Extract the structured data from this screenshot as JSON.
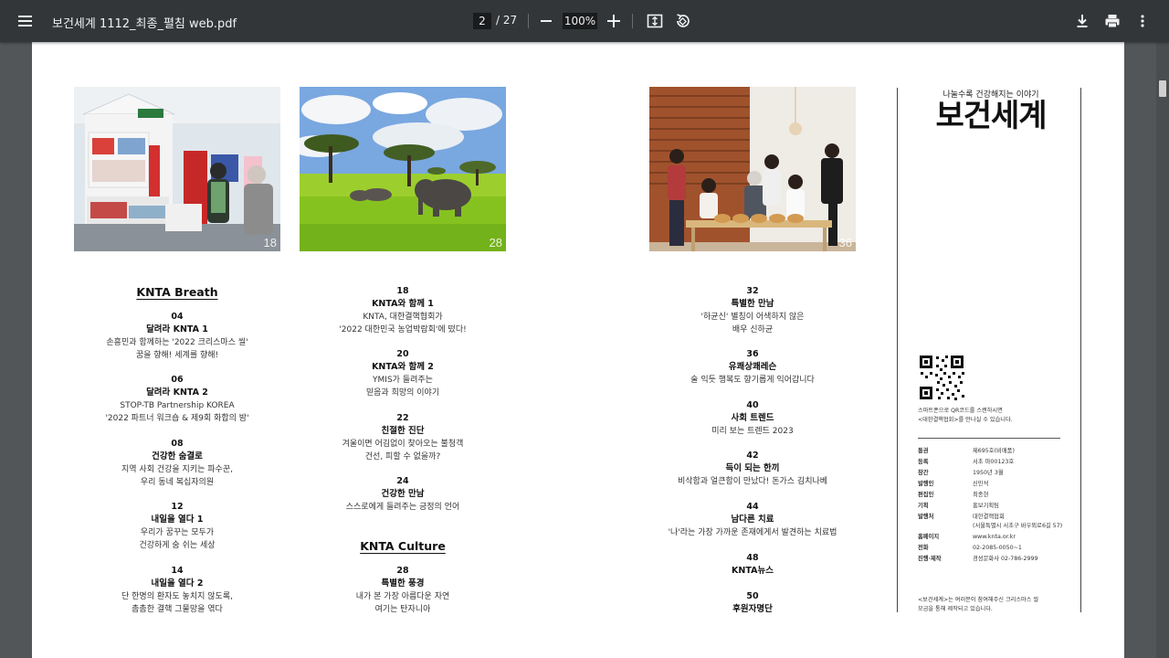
{
  "toolbar": {
    "title": "보건세계 1112_최종_펼침 web.pdf",
    "current_page": "2",
    "total_pages": "/ 27",
    "zoom": "100%"
  },
  "photos": [
    {
      "label": "18"
    },
    {
      "label": "28"
    },
    {
      "label": "36"
    }
  ],
  "sections": {
    "breath": "KNTA Breath",
    "culture": "KNTA Culture"
  },
  "toc": {
    "col1": [
      {
        "num": "04",
        "title": "달려라 KNTA 1",
        "desc": [
          "손흥민과 함께하는 '2022 크리스마스 씰'",
          "꿈을 향해! 세계를 향해!"
        ]
      },
      {
        "num": "06",
        "title": "달려라 KNTA 2",
        "desc": [
          "STOP-TB Partnership KOREA",
          "'2022 파트너 워크숍 & 제9회 화합의 밤'"
        ]
      },
      {
        "num": "08",
        "title": "건강한 숨결로",
        "desc": [
          "지역 사회 건강을 지키는 파수꾼,",
          "우리 동네 복십자의원"
        ]
      },
      {
        "num": "12",
        "title": "내일을 열다 1",
        "desc": [
          "우리가 꿈꾸는 모두가",
          "건강하게 숨 쉬는 세상"
        ]
      },
      {
        "num": "14",
        "title": "내일을 열다 2",
        "desc": [
          "단 한명의 환자도 놓치지 않도록,",
          "촘촘한 결핵 그물망을 엮다"
        ]
      }
    ],
    "col2": [
      {
        "num": "18",
        "title": "KNTA와 함께 1",
        "desc": [
          "KNTA, 대한결핵협회가",
          "'2022 대한민국 농업박람회'에 떴다!"
        ]
      },
      {
        "num": "20",
        "title": "KNTA와 함께 2",
        "desc": [
          "YMIS가 들려주는",
          "믿음과 희망의 이야기"
        ]
      },
      {
        "num": "22",
        "title": "친절한 진단",
        "desc": [
          "겨울이면 어김없이 찾아오는 불청객",
          "건선, 피할 수 없을까?"
        ]
      },
      {
        "num": "24",
        "title": "건강한 만남",
        "desc": [
          "스스로에게 들려주는 긍정의 언어"
        ]
      },
      {
        "num": "28",
        "title": "특별한 풍경",
        "desc": [
          "내가 본 가장 아름다운 자연",
          "여기는 탄자니아"
        ]
      }
    ],
    "col3": [
      {
        "num": "32",
        "title": "특별한 만남",
        "desc": [
          "'하균신' 별칭이 어색하지 않은",
          "배우 신하균"
        ]
      },
      {
        "num": "36",
        "title": "유쾌상쾌레슨",
        "desc": [
          "술 익듯 행복도 향기롭게 익어갑니다"
        ]
      },
      {
        "num": "40",
        "title": "사회 트렌드",
        "desc": [
          "미리 보는 트렌드 2023"
        ]
      },
      {
        "num": "42",
        "title": "득이 되는 한끼",
        "desc": [
          "비삭함과 얼큰함이 만났다! 돈가스 김치나베"
        ]
      },
      {
        "num": "44",
        "title": "남다른 치료",
        "desc": [
          "'나'라는 가장 가까운 존재에게서 발견하는 치료법"
        ]
      },
      {
        "num": "48",
        "title": "KNTA뉴스",
        "desc": []
      },
      {
        "num": "50",
        "title": "후원자명단",
        "desc": []
      }
    ]
  },
  "masthead": {
    "subtitle": "나눌수록 건강해지는 이야기",
    "logo_text": "보건세계",
    "qr_caption": [
      "스마트폰으로 QR코드를 스캔하시면",
      "<대한결핵협회>를 만나실 수 있습니다."
    ],
    "publication": [
      {
        "k": "통권",
        "v": "제695호(비매품)"
      },
      {
        "k": "등록",
        "v": "서초 마00123호"
      },
      {
        "k": "창간",
        "v": "1950년 3월"
      },
      {
        "k": "발행인",
        "v": "신민석"
      },
      {
        "k": "편집인",
        "v": "최종현"
      },
      {
        "k": "기획",
        "v": "홍보기획팀"
      },
      {
        "k": "발행처",
        "v": "대한결핵협회"
      },
      {
        "k": "",
        "v": "(서울특별시 서초구 바우뫼로6길 57)"
      },
      {
        "k": "홈페이지",
        "v": "www.knta.or.kr"
      },
      {
        "k": "전화",
        "v": "02-2085-0050~1"
      },
      {
        "k": "진행·제작",
        "v": "경성문화사 02-786-2999"
      }
    ],
    "note": [
      "<보건세계>는 여러분이 참여해주신 크리스마스 씰",
      "모금을 통해 제작되고 있습니다."
    ]
  }
}
